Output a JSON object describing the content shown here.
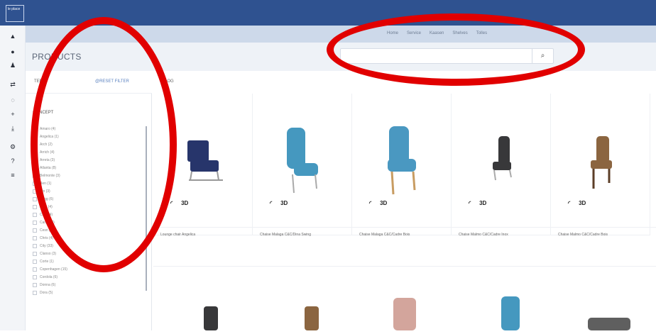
{
  "app": {
    "logo_text": "le\nplace"
  },
  "nav": {
    "links": [
      "Home",
      "Service",
      "Kaasen",
      "Shelves",
      "Tolles"
    ]
  },
  "page": {
    "title": "PRODUCTS"
  },
  "search": {
    "placeholder": ""
  },
  "filter": {
    "label": "TER",
    "reset_label": "@RESET FILTER",
    "catalog_label": "ALOG",
    "concept_label": "CONCEPT"
  },
  "filter_items": [
    "Amaro (4)",
    "Angelica (1)",
    "Arch (2)",
    "Arrich (4)",
    "Arreta (3)",
    "Atlanta (8)",
    "Belmonte (3)",
    "Ben (1)",
    "Bin (3)",
    "Brigg (6)",
    "Bary (4)",
    "Cery (4)",
    "Carso (8)",
    "Cesri (5)",
    "Chris (4)",
    "City (33)",
    "Clanso (3)",
    "Corte (1)",
    "Copenhagen (15)",
    "Cordola (6)",
    "Donna (6)",
    "Dora (5)"
  ],
  "products": [
    {
      "name": "Lounge chair Angelica",
      "color": "#27356b",
      "tools": [
        "◜",
        "3D"
      ]
    },
    {
      "name": "Chaise Malaga C&C/Dina Swing",
      "color": "#4598bf",
      "tools": [
        "◜",
        "3D"
      ]
    },
    {
      "name": "Chaise Malaga C&C/Cadre Bois",
      "color": "#4a98c1",
      "tools": [
        "◜",
        "3D"
      ]
    },
    {
      "name": "Chaise Malmo C&C/Cadre Inox",
      "color": "#38383a",
      "tools": [
        "◜",
        "3D"
      ]
    },
    {
      "name": "Chaise Malmo C&C/Cadre Bois",
      "color": "#8b6540",
      "tools": [
        "◜",
        "3D"
      ]
    }
  ],
  "colors": {
    "topbar": "#2f5290",
    "accent": "#e10000"
  }
}
